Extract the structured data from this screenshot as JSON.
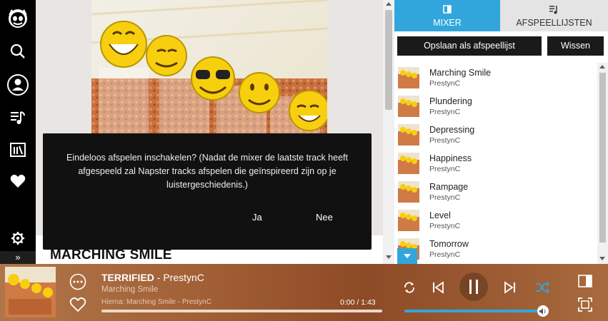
{
  "nav": {
    "items": [
      "logo-icon",
      "search-icon",
      "account-icon",
      "library-icon",
      "radio-icon",
      "heart-icon",
      "gear-icon"
    ],
    "expand_label": "»"
  },
  "main": {
    "title": "MARCHING SMILE"
  },
  "modal": {
    "message": "Eindeloos afspelen inschakelen? (Nadat de mixer de laatste track heeft afgespeeld zal Napster tracks afspelen die geïnspireerd zijn op je luistergeschiedenis.)",
    "yes_label": "Ja",
    "no_label": "Nee"
  },
  "right_panel": {
    "tabs": [
      {
        "label": "MIXER",
        "active": true
      },
      {
        "label": "AFSPEELLIJSTEN",
        "active": false
      }
    ],
    "save_label": "Opslaan als afspeellijst",
    "clear_label": "Wissen",
    "tracks": [
      {
        "name": "Marching Smile",
        "artist": "PrestynC"
      },
      {
        "name": "Plundering",
        "artist": "PrestynC"
      },
      {
        "name": "Depressing",
        "artist": "PrestynC"
      },
      {
        "name": "Happiness",
        "artist": "PrestynC"
      },
      {
        "name": "Rampage",
        "artist": "PrestynC"
      },
      {
        "name": "Level",
        "artist": "PrestynC"
      },
      {
        "name": "Tomorrow",
        "artist": "PrestynC"
      }
    ]
  },
  "player": {
    "track": "TERRIFIED",
    "artist_suffix": " - PrestynC",
    "album": "Marching Smile",
    "next_up": "Hierna: Marching Smile - PrestynC",
    "time": "0:00 / 1:43",
    "progress": 0.0,
    "volume": 1.0
  },
  "colors": {
    "accent": "#31a6dc",
    "nav_bg": "#000000",
    "player_bg": "#a15e34"
  }
}
